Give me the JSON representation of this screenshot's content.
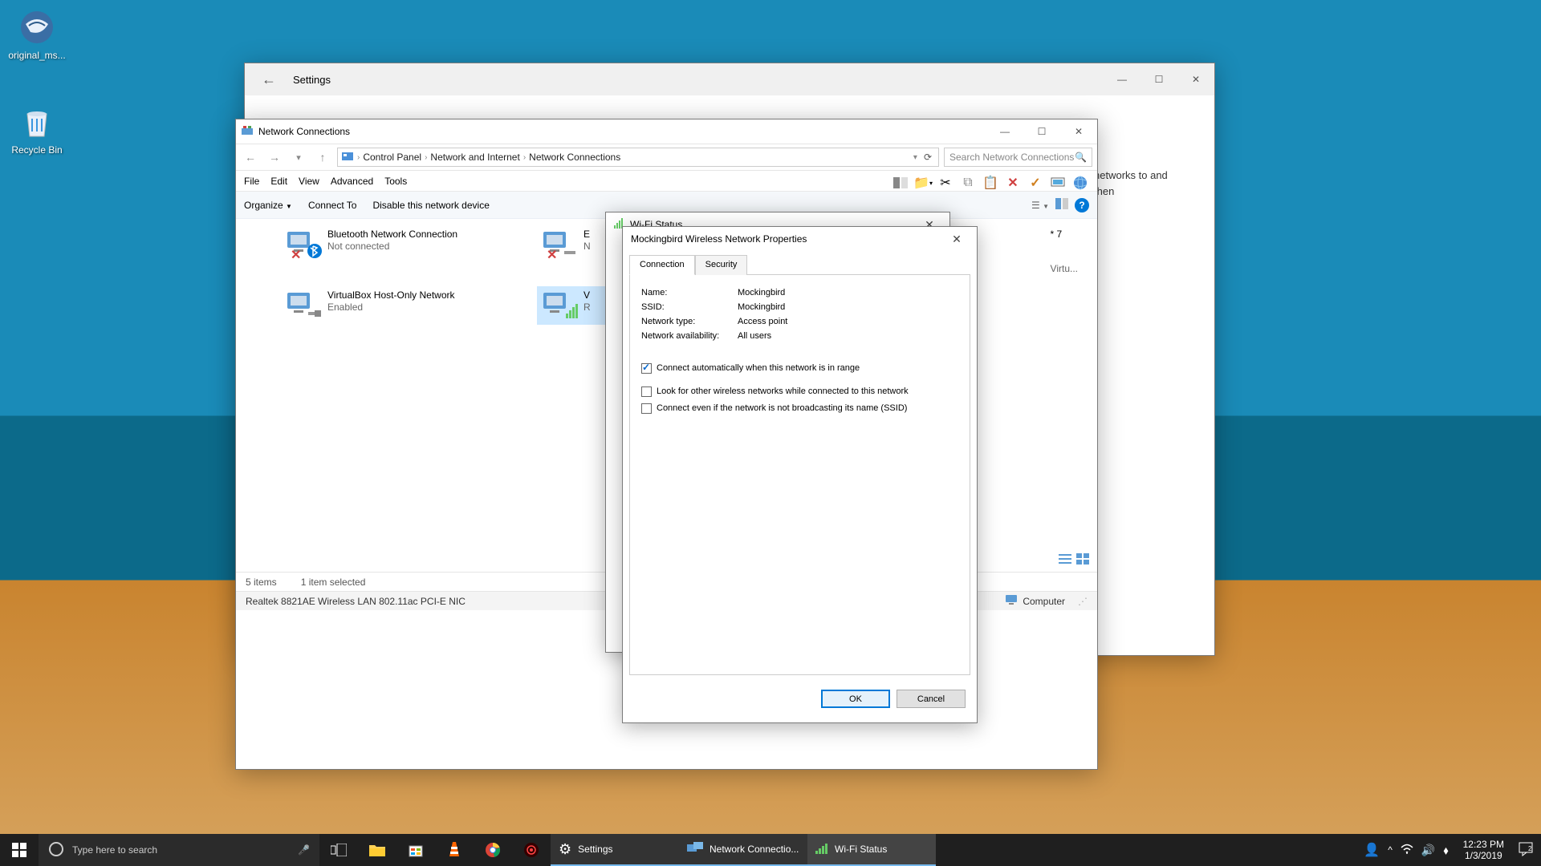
{
  "desktop": {
    "icons": [
      {
        "name": "thunderbird-shortcut",
        "label": "original_ms..."
      },
      {
        "name": "recycle-bin",
        "label": "Recycle Bin"
      }
    ]
  },
  "settings_window": {
    "title": "Settings",
    "back_text": "networks to and then"
  },
  "nc_window": {
    "title": "Network Connections",
    "breadcrumb": [
      "Control Panel",
      "Network and Internet",
      "Network Connections"
    ],
    "search_placeholder": "Search Network Connections",
    "menu": [
      "File",
      "Edit",
      "View",
      "Advanced",
      "Tools"
    ],
    "cmdbar": {
      "organize": "Organize",
      "connect": "Connect To",
      "disable": "Disable this network device"
    },
    "connections": [
      {
        "name": "Bluetooth Network Connection",
        "status": "Not connected",
        "icon": "bt-disabled"
      },
      {
        "name": "VirtualBox Host-Only Network",
        "status": "Enabled",
        "icon": "net"
      },
      {
        "name": "E",
        "status": "N",
        "icon": "net-disabled",
        "partial": true
      },
      {
        "name": "V",
        "status": "R",
        "icon": "wifi",
        "partial": true,
        "selected": true
      }
    ],
    "extra_right": {
      "line1": "* 7",
      "line2": "Virtu..."
    },
    "status": {
      "items": "5 items",
      "selected": "1 item selected"
    },
    "details": "Realtek 8821AE Wireless LAN 802.11ac PCI-E NIC",
    "computer": "Computer"
  },
  "wifi_status": {
    "title": "Wi-Fi Status"
  },
  "props_dialog": {
    "title": "Mockingbird Wireless Network Properties",
    "tabs": [
      "Connection",
      "Security"
    ],
    "rows": [
      {
        "k": "Name:",
        "v": "Mockingbird"
      },
      {
        "k": "SSID:",
        "v": "Mockingbird"
      },
      {
        "k": "Network type:",
        "v": "Access point"
      },
      {
        "k": "Network availability:",
        "v": "All users"
      }
    ],
    "checks": [
      {
        "label": "Connect automatically when this network is in range",
        "checked": true
      },
      {
        "label": "Look for other wireless networks while connected to this network",
        "checked": false
      },
      {
        "label": "Connect even if the network is not broadcasting its name (SSID)",
        "checked": false
      }
    ],
    "ok": "OK",
    "cancel": "Cancel"
  },
  "taskbar": {
    "search_placeholder": "Type here to search",
    "apps": [
      {
        "label": "Settings",
        "icon": "gear"
      },
      {
        "label": "Network Connectio...",
        "icon": "net"
      },
      {
        "label": "Wi-Fi Status",
        "icon": "wifi",
        "active": true
      }
    ],
    "time": "12:23 PM",
    "date": "1/3/2019"
  }
}
